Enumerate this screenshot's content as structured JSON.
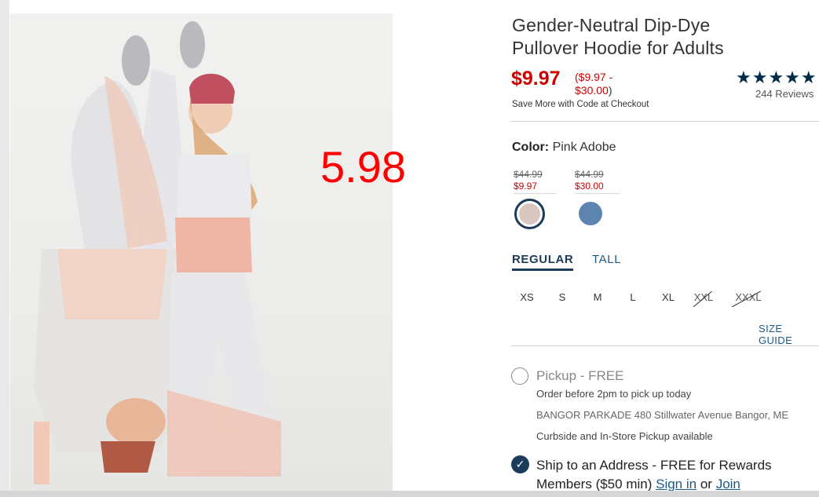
{
  "overlay_price": "5.98",
  "product": {
    "title": "Gender-Neutral Dip-Dye Pullover Hoodie for Adults",
    "price": "$9.97",
    "price_range_open": "(",
    "price_range_low": "$9.97 -",
    "price_range_high": "$30.00",
    "price_range_close": ")",
    "save_more": "Save More with Code at Checkout",
    "stars": "★★★★★",
    "rating": 5,
    "reviews": "244 Reviews"
  },
  "color": {
    "label": "Color:",
    "value": "Pink Adobe",
    "swatches": [
      {
        "name": "Pink Adobe",
        "original": "$44.99",
        "sale": "$9.97",
        "color": "#d9c7bf",
        "selected": true
      },
      {
        "name": "Blue",
        "original": "$44.99",
        "sale": "$30.00",
        "color": "#5e84b2",
        "selected": false
      }
    ]
  },
  "fit_tabs": [
    "REGULAR",
    "TALL"
  ],
  "sizes": [
    "XS",
    "S",
    "M",
    "L",
    "XL",
    "XXL",
    "XXXL"
  ],
  "unavailable_sizes": [
    "XXL",
    "XXXL"
  ],
  "size_guide": "SIZE GUIDE",
  "fulfillment": {
    "pickup_title": "Pickup - FREE",
    "pickup_line1": "Order before 2pm to pick up today",
    "store_line": "BANGOR PARKADE 480 Stillwater Avenue  Bangor, ME",
    "pickup_line3": "Curbside and In-Store Pickup available",
    "ship_text": "Ship to an Address - FREE for Rewards Members ($50 min)",
    "sign_in": "Sign in",
    "or": "or",
    "join": "Join",
    "check_glyph": "✓"
  },
  "colors": {
    "sale_red": "#cc0000",
    "navy": "#1b3b5a",
    "overlay_red": "#ff0000"
  }
}
